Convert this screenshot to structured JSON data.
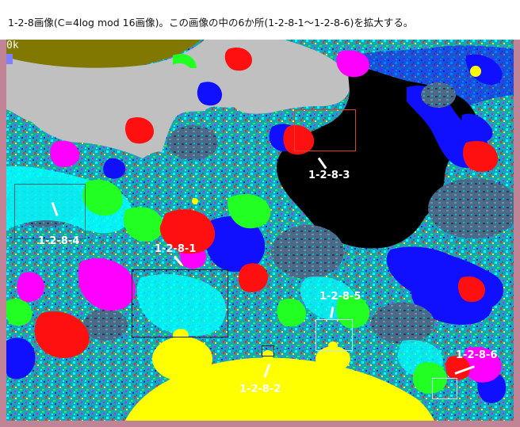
{
  "caption": "1-2-8画像(C=4log mod 16画像)。この画像の中の6か所(1-2-8-1～1-2-8-6)を拡大する。",
  "corner_text": "0k",
  "labels": {
    "r1": "1-2-8-1",
    "r2": "1-2-8-2",
    "r3": "1-2-8-3",
    "r4": "1-2-8-4",
    "r5": "1-2-8-5",
    "r6": "1-2-8-6"
  },
  "colors": {
    "frame": "#c18497",
    "box_red": "#e0402a",
    "box_dark": "#222222",
    "box_cyan": "#bfe8ff"
  }
}
